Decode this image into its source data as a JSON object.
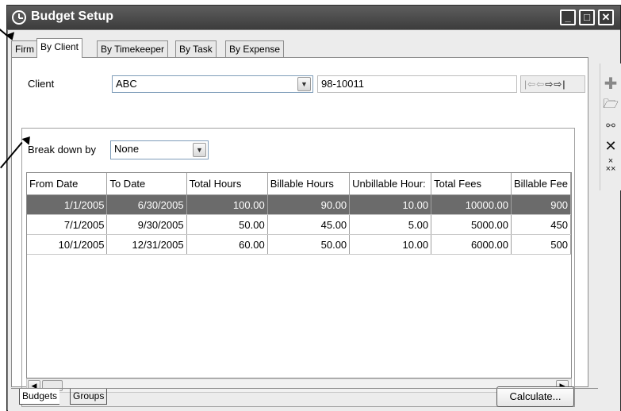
{
  "window": {
    "title": "Budget Setup"
  },
  "tabs": [
    {
      "label": "Firm",
      "active": false
    },
    {
      "label": "By Client",
      "active": true
    },
    {
      "label": "By Timekeeper",
      "active": false
    },
    {
      "label": "By Task",
      "active": false
    },
    {
      "label": "By Expense",
      "active": false
    }
  ],
  "client": {
    "label": "Client",
    "value": "ABC",
    "matter_number": "98-10011"
  },
  "breakdown": {
    "label": "Break down by",
    "value": "None"
  },
  "grid": {
    "columns": [
      "From Date",
      "To Date",
      "Total Hours",
      "Billable Hours",
      "Unbillable Hour:",
      "Total Fees",
      "Billable Fee"
    ],
    "rows": [
      [
        "1/1/2005",
        "6/30/2005",
        "100.00",
        "90.00",
        "10.00",
        "10000.00",
        "900"
      ],
      [
        "7/1/2005",
        "9/30/2005",
        "50.00",
        "45.00",
        "5.00",
        "5000.00",
        "450"
      ],
      [
        "10/1/2005",
        "12/31/2005",
        "60.00",
        "50.00",
        "10.00",
        "6000.00",
        "500"
      ]
    ],
    "selected_row": 0
  },
  "calculate_label": "Calculate...",
  "bottom_tabs": [
    {
      "label": "Budgets",
      "active": true
    },
    {
      "label": "Groups",
      "active": false
    }
  ],
  "toolbar_icons": [
    "add-icon",
    "open-folder-icon",
    "link-icon",
    "delete-icon",
    "delete-all-icon"
  ],
  "colors": {
    "titlebar": "#4a4a4a",
    "selection": "#6b6b6b"
  }
}
